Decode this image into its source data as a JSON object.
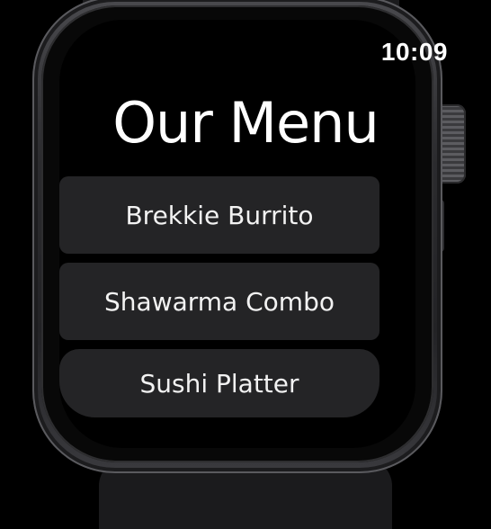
{
  "status_bar": {
    "time": "10:09"
  },
  "screen": {
    "title": "Our Menu"
  },
  "menu": {
    "items": [
      {
        "label": "Brekkie Burrito"
      },
      {
        "label": "Shawarma Combo"
      },
      {
        "label": "Sushi Platter"
      }
    ]
  },
  "colors": {
    "background": "#000000",
    "button_fill": "#242426",
    "text": "#ffffff"
  }
}
